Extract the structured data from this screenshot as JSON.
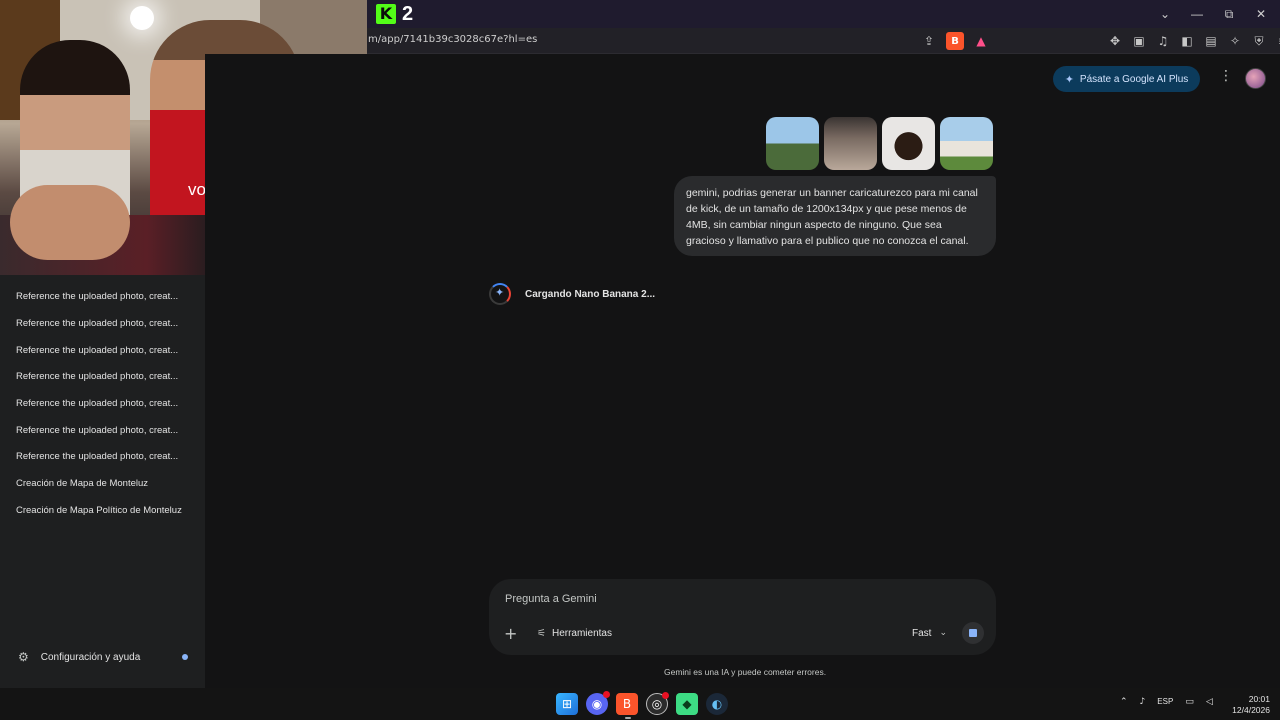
{
  "browser": {
    "tab_logo_letter": "K",
    "tab_logo_number": "2",
    "url": "m/app/7141b39c3028c67e?hl=es",
    "window_controls": [
      "⌄",
      "—",
      "⧉",
      "✕"
    ]
  },
  "header": {
    "upgrade_label": "Pásate a Google AI Plus",
    "more_icon": "⋮"
  },
  "sidebar": {
    "items": [
      "Reference the uploaded photo, creat...",
      "Reference the uploaded photo, creat...",
      "Reference the uploaded photo, creat...",
      "Reference the uploaded photo, creat...",
      "Reference the uploaded photo, creat...",
      "Reference the uploaded photo, creat...",
      "Reference the uploaded photo, creat...",
      "Creación de Mapa de Monteluz",
      "Creación de Mapa Político de Monteluz"
    ],
    "settings_label": "Configuración y ayuda"
  },
  "chat": {
    "user_message": "gemini, podrias generar un banner caricaturezco para mi canal de kick, de un tamaño de 1200x134px y que pese menos de 4MB, sin cambiar ningun aspecto de ninguno. Que sea gracioso y llamativo para el publico que no conozca el canal.",
    "loading_text": "Cargando Nano Banana 2..."
  },
  "composer": {
    "placeholder": "Pregunta a Gemini",
    "plus_icon": "+",
    "tools_label": "Herramientas",
    "mode_label": "Fast",
    "mode_chevron": "⌄"
  },
  "footer": {
    "disclaimer": "Gemini es una IA y puede cometer errores."
  },
  "webcam": {
    "shirt_text": "vodafone"
  },
  "taskbar": {
    "language": "ESP",
    "time": "20:01",
    "date": "12/4/2026"
  }
}
